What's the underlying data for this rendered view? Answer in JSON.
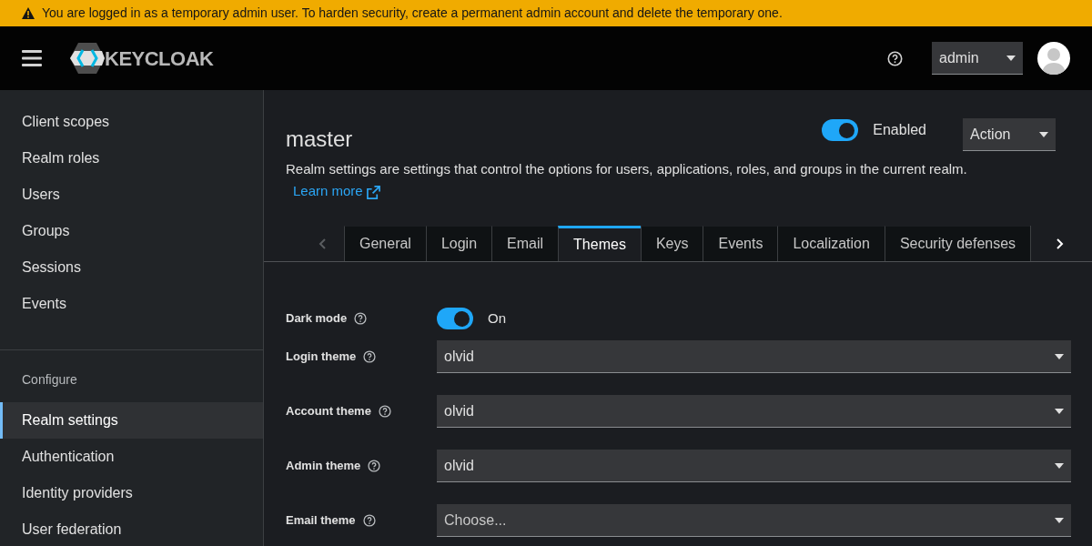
{
  "banner": {
    "text": "You are logged in as a temporary admin user. To harden security, create a permanent admin account and delete the temporary one."
  },
  "header": {
    "logo": "KEYCLOAK",
    "user_menu": "admin"
  },
  "sidebar": {
    "groups": [
      {
        "items": [
          {
            "label": "Client scopes",
            "selected": false
          },
          {
            "label": "Realm roles",
            "selected": false
          },
          {
            "label": "Users",
            "selected": false
          },
          {
            "label": "Groups",
            "selected": false
          },
          {
            "label": "Sessions",
            "selected": false
          },
          {
            "label": "Events",
            "selected": false
          }
        ]
      },
      {
        "heading": "Configure",
        "items": [
          {
            "label": "Realm settings",
            "selected": true
          },
          {
            "label": "Authentication",
            "selected": false
          },
          {
            "label": "Identity providers",
            "selected": false
          },
          {
            "label": "User federation",
            "selected": false
          }
        ]
      }
    ]
  },
  "page": {
    "title": "master",
    "enabled": {
      "label": "Enabled",
      "on": true
    },
    "action": "Action",
    "description": "Realm settings are settings that control the options for users, applications, roles, and groups in the current realm.",
    "learn_more": "Learn more"
  },
  "tabs": {
    "scroll_left": {
      "disabled": true
    },
    "scroll_right": {
      "disabled": false
    },
    "items": [
      {
        "label": "General",
        "selected": false
      },
      {
        "label": "Login",
        "selected": false
      },
      {
        "label": "Email",
        "selected": false
      },
      {
        "label": "Themes",
        "selected": true
      },
      {
        "label": "Keys",
        "selected": false
      },
      {
        "label": "Events",
        "selected": false
      },
      {
        "label": "Localization",
        "selected": false
      },
      {
        "label": "Security defenses",
        "selected": false
      }
    ]
  },
  "form": [
    {
      "kind": "toggle",
      "label": "Dark mode",
      "on": true,
      "state_label": "On"
    },
    {
      "kind": "select",
      "label": "Login theme",
      "value": "olvid"
    },
    {
      "kind": "select",
      "label": "Account theme",
      "value": "olvid"
    },
    {
      "kind": "select",
      "label": "Admin theme",
      "value": "olvid"
    },
    {
      "kind": "select",
      "label": "Email theme",
      "placeholder": "Choose..."
    }
  ]
}
